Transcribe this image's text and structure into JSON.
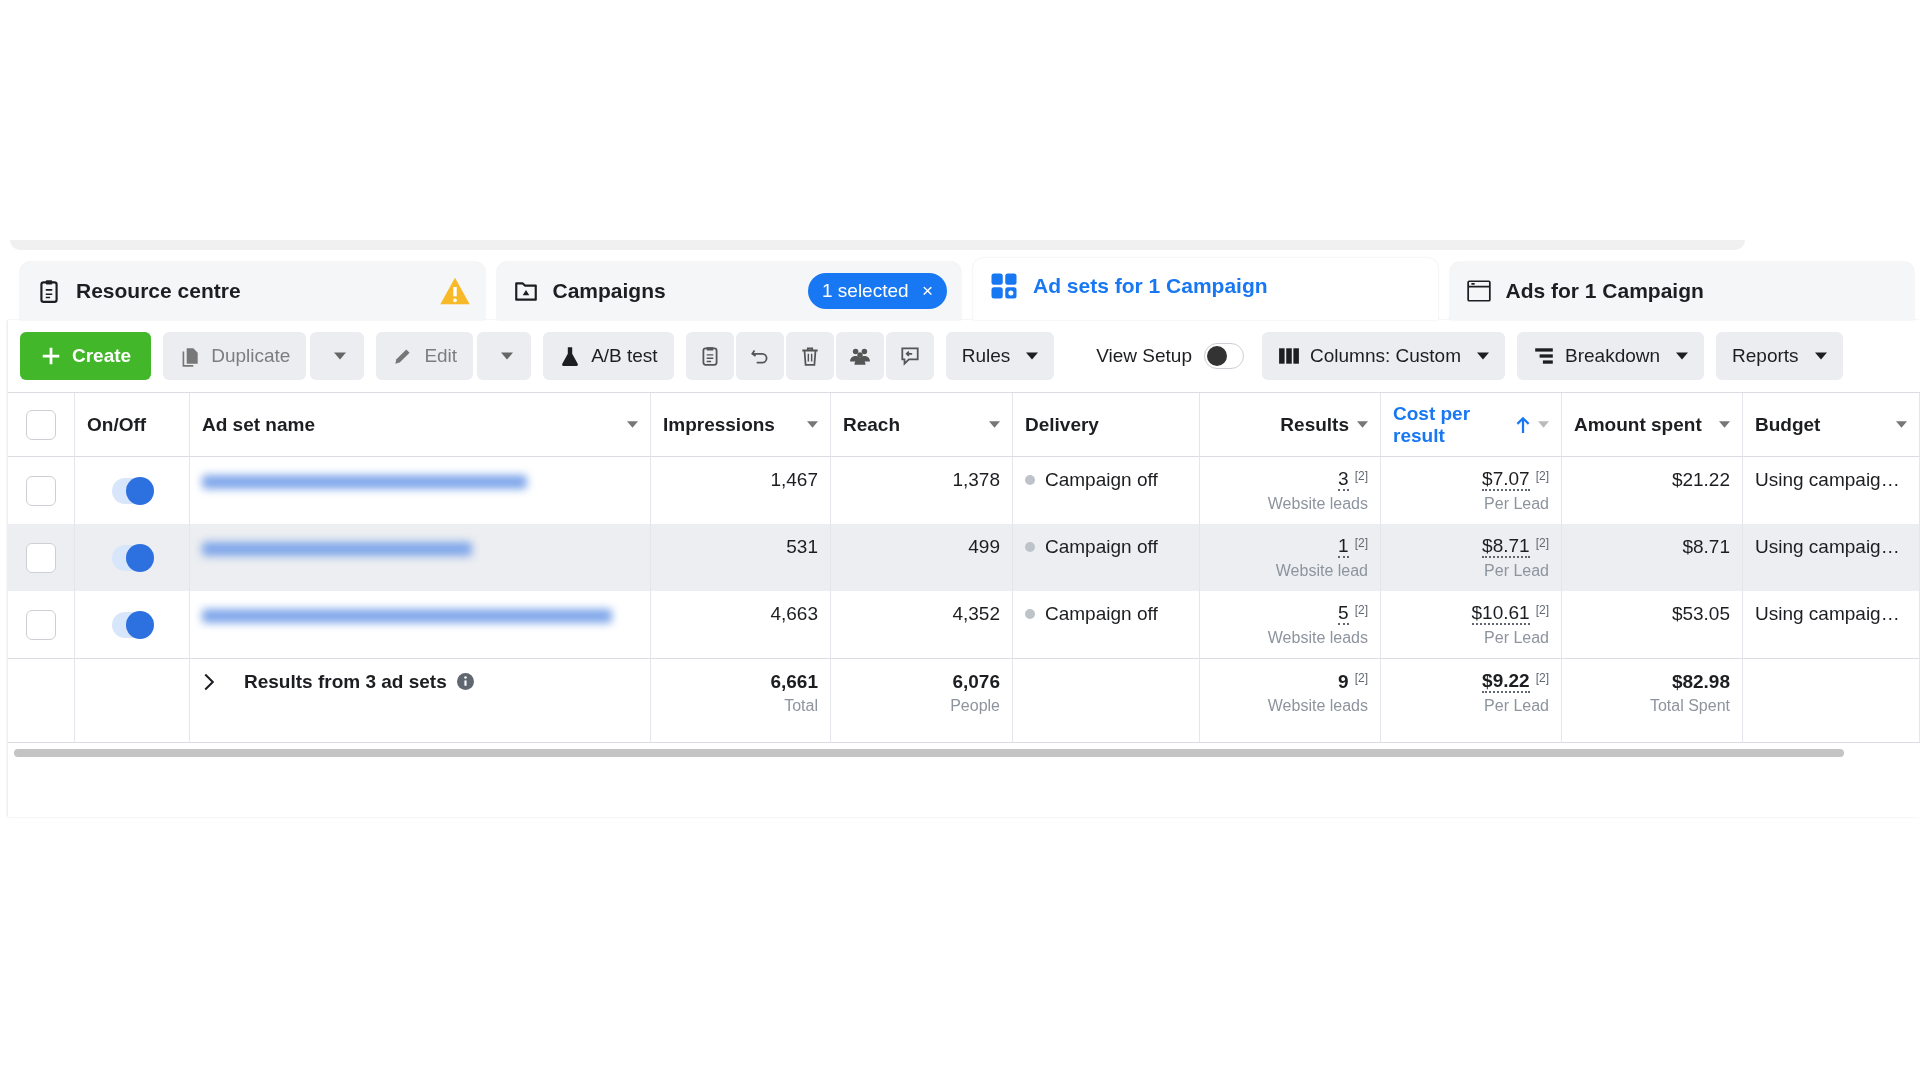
{
  "tabs": [
    {
      "label": "Resource centre",
      "selected": false,
      "warning": true
    },
    {
      "label": "Campaigns",
      "selected": false,
      "chip": "1 selected",
      "chip_close": "×"
    },
    {
      "label": "Ad sets for 1 Campaign",
      "selected": true
    },
    {
      "label": "Ads for 1 Campaign",
      "selected": false
    }
  ],
  "toolbar": [
    {
      "kind": "primary",
      "label": "Create"
    },
    {
      "kind": "split",
      "label": "Duplicate",
      "disabled": true
    },
    {
      "kind": "split",
      "label": "Edit",
      "disabled": true
    },
    {
      "kind": "text",
      "label": "A/B test"
    },
    {
      "kind": "icon"
    },
    {
      "kind": "icon"
    },
    {
      "kind": "icon"
    },
    {
      "kind": "icon"
    },
    {
      "kind": "icon"
    },
    {
      "kind": "menu",
      "label": "Rules"
    },
    {
      "kind": "switch",
      "label": "View Setup",
      "on": false
    },
    {
      "kind": "menu",
      "label": "Columns: Custom"
    },
    {
      "kind": "menu",
      "label": "Breakdown"
    },
    {
      "kind": "menu",
      "label": "Reports"
    }
  ],
  "table": {
    "select_all": {
      "checked": false
    },
    "columns": [
      {
        "label": "On/Off",
        "menu": false,
        "sorted": false
      },
      {
        "label": "Ad set name",
        "menu": true,
        "sorted": false
      },
      {
        "label": "Impressions",
        "menu": true,
        "sorted": false
      },
      {
        "label": "Reach",
        "menu": true,
        "sorted": false
      },
      {
        "label": "Delivery",
        "menu": false,
        "sorted": false
      },
      {
        "label": "Results",
        "menu": true,
        "sorted": false
      },
      {
        "label": "Cost per result",
        "menu": true,
        "sorted": true
      },
      {
        "label": "Amount spent",
        "menu": true,
        "sorted": false
      },
      {
        "label": "Budget",
        "menu": true,
        "sorted": false
      }
    ],
    "rows": [
      {
        "checked": false,
        "on": true,
        "highlighted": false,
        "impressions": "1,467",
        "reach": "1,378",
        "delivery": "Campaign off",
        "results": "3",
        "results_note": "[2]",
        "results_label": "Website leads",
        "cost": "$7.07",
        "cost_note": "[2]",
        "cost_label": "Per Lead",
        "amount": "$21.22",
        "budget": "Using campaig…"
      },
      {
        "checked": false,
        "on": true,
        "highlighted": true,
        "impressions": "531",
        "reach": "499",
        "delivery": "Campaign off",
        "results": "1",
        "results_note": "[2]",
        "results_label": "Website lead",
        "cost": "$8.71",
        "cost_note": "[2]",
        "cost_label": "Per Lead",
        "amount": "$8.71",
        "budget": "Using campaig…"
      },
      {
        "checked": false,
        "on": true,
        "highlighted": false,
        "impressions": "4,663",
        "reach": "4,352",
        "delivery": "Campaign off",
        "results": "5",
        "results_note": "[2]",
        "results_label": "Website leads",
        "cost": "$10.61",
        "cost_note": "[2]",
        "cost_label": "Per Lead",
        "amount": "$53.05",
        "budget": "Using campaig…"
      }
    ],
    "summary": {
      "label": "Results from 3 ad sets",
      "impressions": "6,661",
      "impressions_label": "Total",
      "reach": "6,076",
      "reach_label": "People",
      "results": "9",
      "results_note": "[2]",
      "results_label": "Website leads",
      "cost": "$9.22",
      "cost_note": "[2]",
      "cost_label": "Per Lead",
      "amount": "$82.98",
      "amount_label": "Total Spent"
    }
  }
}
